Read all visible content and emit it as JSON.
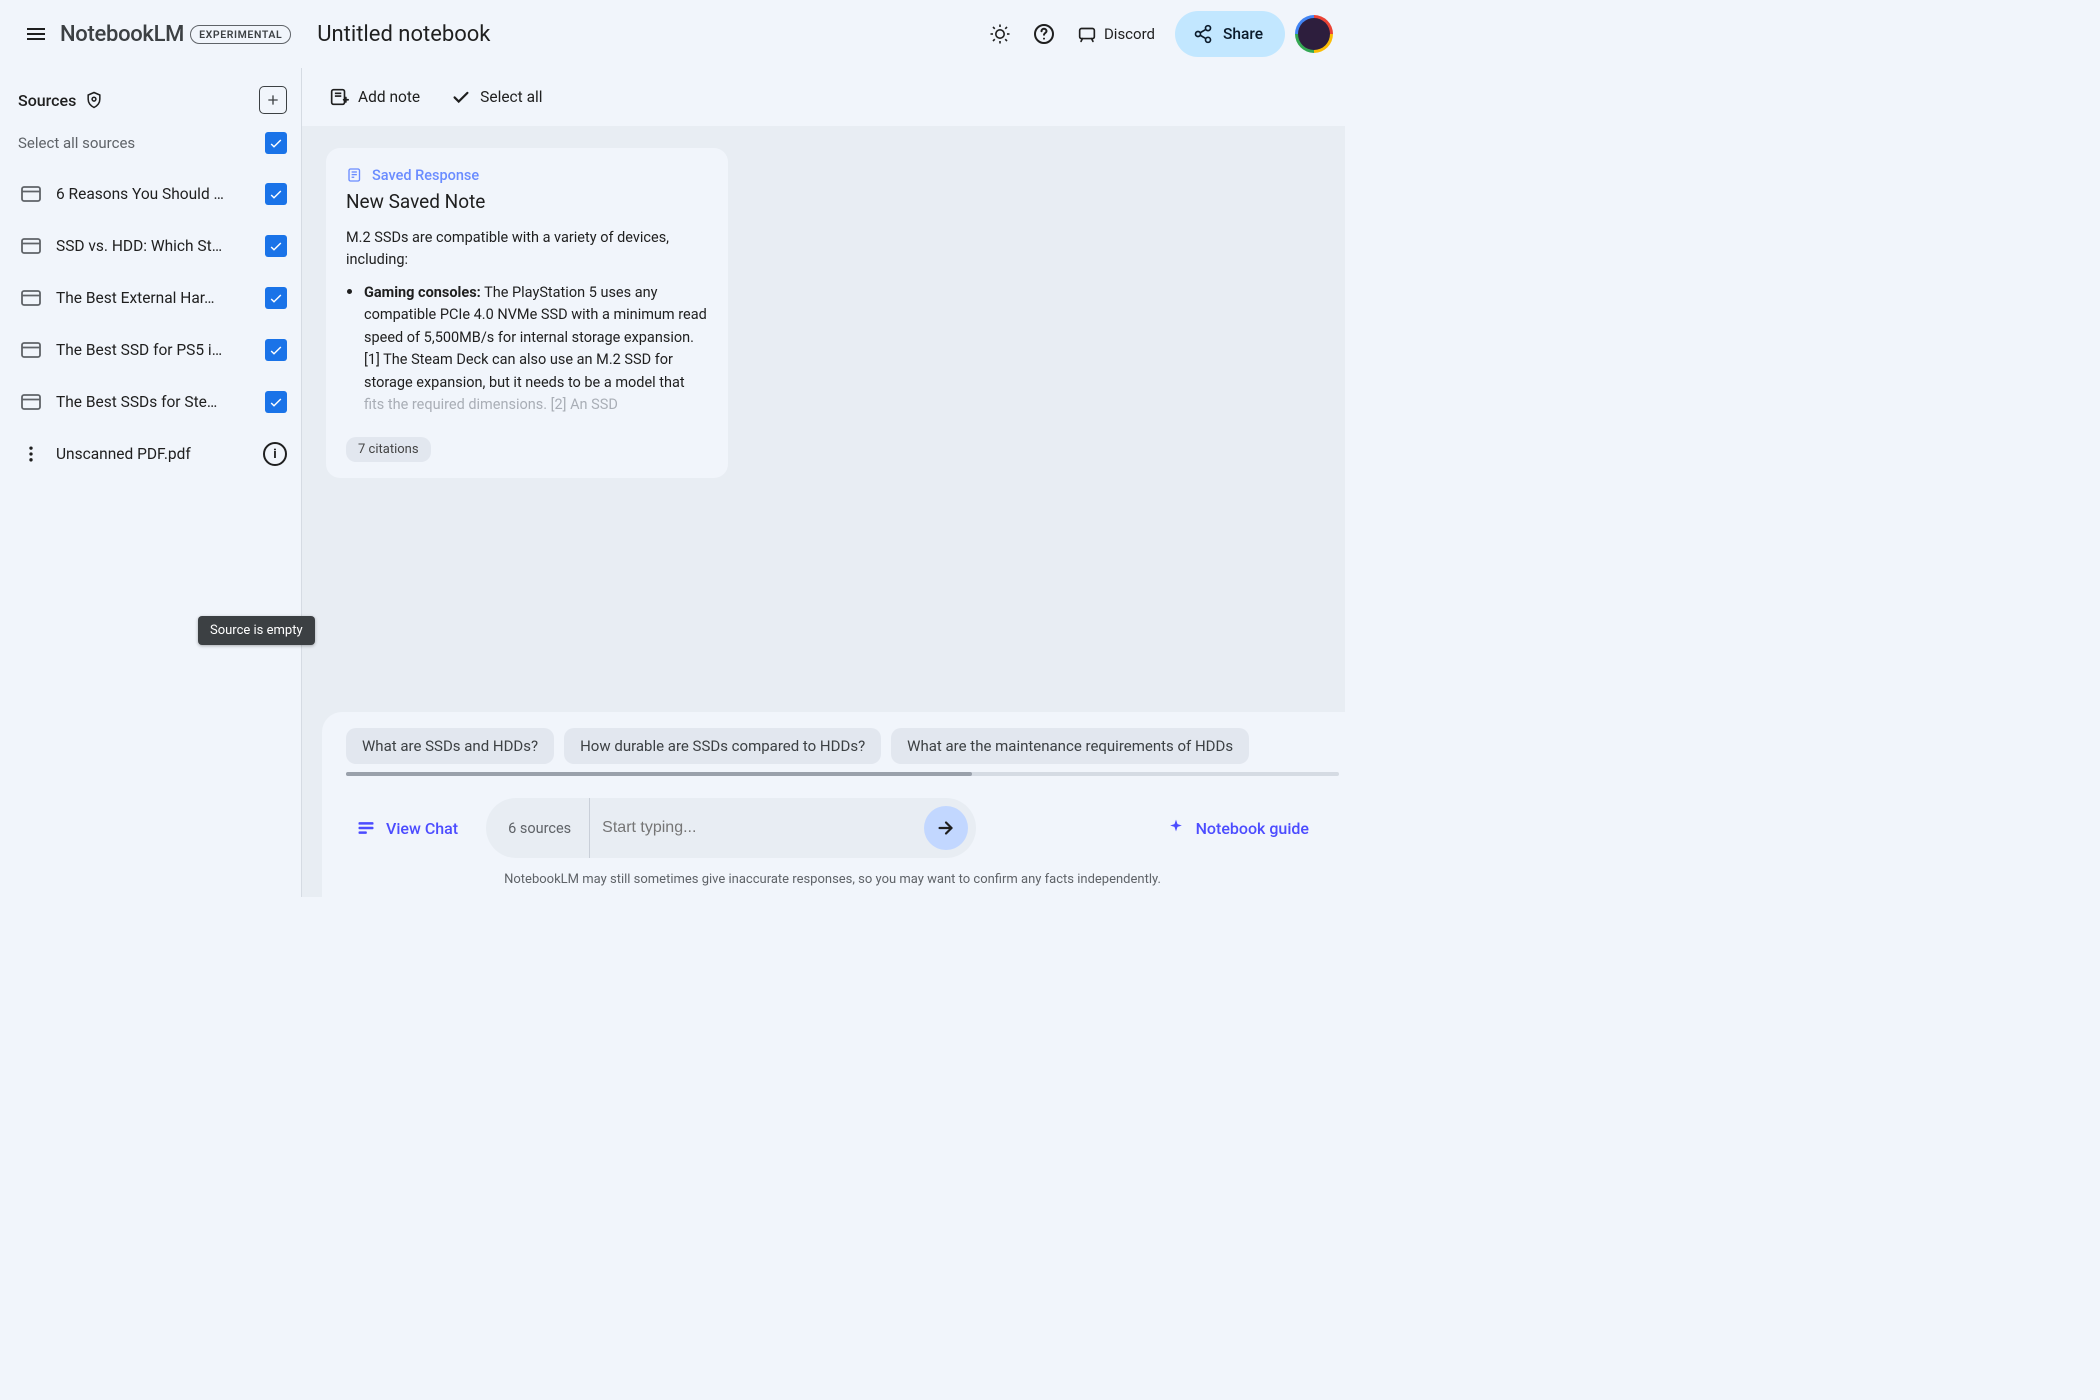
{
  "brand": {
    "name": "NotebookLM",
    "badge": "EXPERIMENTAL"
  },
  "notebook_title": "Untitled notebook",
  "header": {
    "discord_label": "Discord",
    "share_label": "Share"
  },
  "sidebar": {
    "sources_label": "Sources",
    "select_all_label": "Select all sources",
    "items": [
      {
        "label": "6 Reasons You Should …",
        "checked": true
      },
      {
        "label": "SSD vs. HDD: Which St…",
        "checked": true
      },
      {
        "label": "The Best External Har…",
        "checked": true
      },
      {
        "label": "The Best SSD for PS5 i…",
        "checked": true
      },
      {
        "label": "The Best SSDs for Ste…",
        "checked": true
      }
    ],
    "pdf_item": {
      "label": "Unscanned PDF.pdf",
      "tooltip": "Source is empty"
    }
  },
  "toolbar": {
    "add_note_label": "Add note",
    "select_all_label": "Select all"
  },
  "note": {
    "saved_response_label": "Saved Response",
    "title": "New Saved Note",
    "intro": "M.2 SSDs are compatible with a variety of devices, including:",
    "bullet_bold": "Gaming consoles:",
    "bullet_text_1": " The PlayStation 5 uses any compatible PCIe 4.0 NVMe SSD with a minimum read speed of 5,500MB/s for internal storage expansion. [1] The Steam Deck can also use an M.2 SSD for storage expansion, but it needs to be a model that ",
    "bullet_text_fade": "fits the required dimensions. [2] An SSD",
    "citations": "7 citations"
  },
  "suggestions": [
    "What are SSDs and HDDs?",
    "How durable are SSDs compared to HDDs?",
    "What are the maintenance requirements of HDDs"
  ],
  "dock": {
    "view_chat_label": "View Chat",
    "source_count": "6 sources",
    "input_placeholder": "Start typing...",
    "notebook_guide_label": "Notebook guide",
    "disclaimer": "NotebookLM may still sometimes give inaccurate responses, so you may want to confirm any facts independently."
  }
}
